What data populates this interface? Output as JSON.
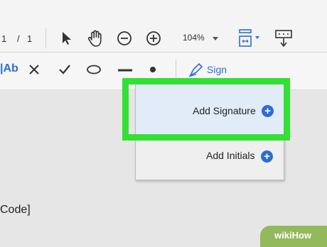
{
  "toolbar": {
    "page_current": "1",
    "page_separator": "/",
    "page_total": "1",
    "zoom_value": "104%"
  },
  "annotation_toolbar": {
    "text_tool_label": "|Ab",
    "sign_label": "Sign"
  },
  "signature_menu": {
    "add_signature_label": "Add Signature",
    "add_initials_label": "Add Initials"
  },
  "document": {
    "visible_text": "Code]"
  },
  "watermark": {
    "text": "wikiHow"
  },
  "colors": {
    "accent": "#2d6dd0",
    "highlight": "#33e033"
  }
}
